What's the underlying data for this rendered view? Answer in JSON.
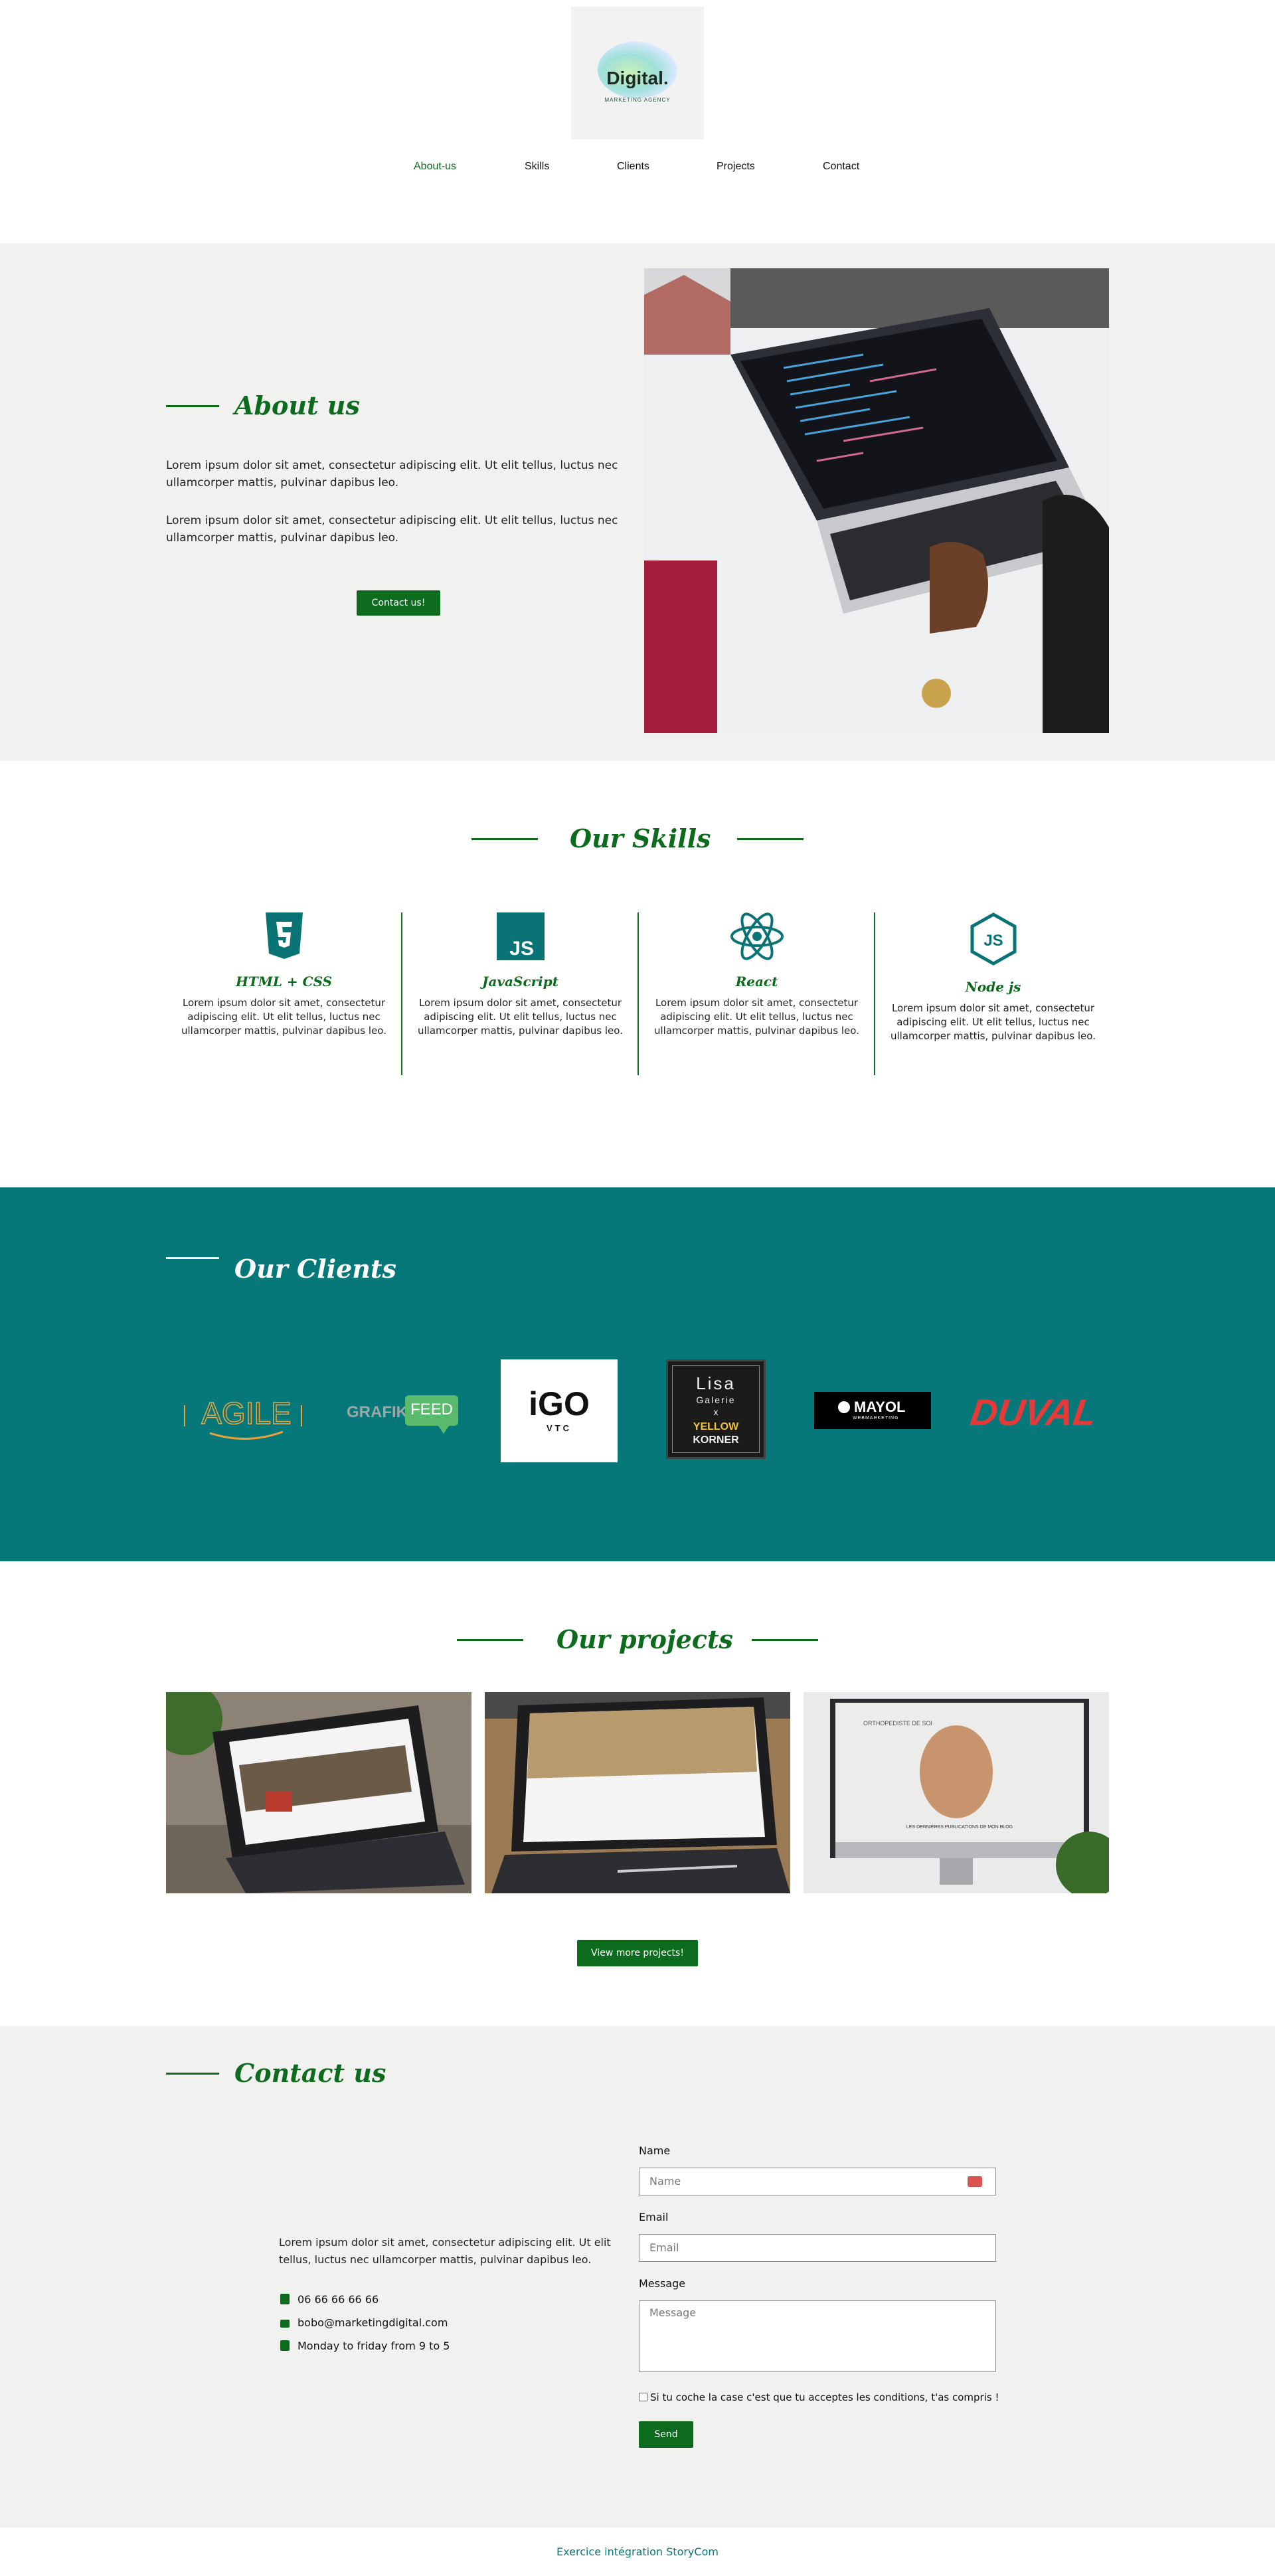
{
  "brand": {
    "name": "Digital.",
    "tagline": "MARKETING AGENCY"
  },
  "nav": [
    {
      "label": "About-us",
      "active": true
    },
    {
      "label": "Skills"
    },
    {
      "label": "Clients"
    },
    {
      "label": "Projects"
    },
    {
      "label": "Contact"
    }
  ],
  "about": {
    "title": "About us",
    "paragraph1": "Lorem ipsum dolor sit amet, consectetur adipiscing elit. Ut elit tellus, luctus nec ullamcorper mattis, pulvinar dapibus leo.",
    "paragraph2": "Lorem ipsum dolor sit amet, consectetur adipiscing elit. Ut elit tellus, luctus nec ullamcorper mattis, pulvinar dapibus leo.",
    "button": "Contact us!"
  },
  "skills": {
    "title": "Our Skills",
    "items": [
      {
        "title": "HTML + CSS",
        "text": "Lorem ipsum dolor sit amet, consectetur adipiscing elit. Ut elit tellus, luctus nec ullamcorper mattis, pulvinar dapibus leo.",
        "icon": "html5-icon"
      },
      {
        "title": "JavaScript",
        "text": "Lorem ipsum dolor sit amet, consectetur adipiscing elit. Ut elit tellus, luctus nec ullamcorper mattis, pulvinar dapibus leo.",
        "icon": "javascript-icon"
      },
      {
        "title": "React",
        "text": "Lorem ipsum dolor sit amet, consectetur adipiscing elit. Ut elit tellus, luctus nec ullamcorper mattis, pulvinar dapibus leo.",
        "icon": "react-icon"
      },
      {
        "title": "Node js",
        "text": "Lorem ipsum dolor sit amet, consectetur adipiscing elit. Ut elit tellus, luctus nec ullamcorper mattis, pulvinar dapibus leo.",
        "icon": "nodejs-icon"
      }
    ]
  },
  "clients": {
    "title": "Our Clients",
    "logos": {
      "agile": "AGILE",
      "grafik": "GRAFIK",
      "feed": "FEED",
      "igo_main": "iGO",
      "igo_sub": "VTC",
      "lisa_1": "Lisa",
      "lisa_2": "Galerie",
      "lisa_x": "x",
      "lisa_3": "YELLOW",
      "lisa_4": "KORNER",
      "mayol": "MAYOL",
      "mayol_sub": "WEBMARKETING",
      "duval": "DUVAL"
    }
  },
  "projects": {
    "title": "Our projects",
    "button": "View more projects!",
    "mock_text_1": "ORTHOPEDISTE DE SOI",
    "mock_text_2": "LES DERNIÈRES PUBLICATIONS DE MON BLOG"
  },
  "contact": {
    "title": "Contact us",
    "intro": "Lorem ipsum dolor sit amet, consectetur adipiscing elit. Ut elit tellus, luctus nec ullamcorper mattis, pulvinar dapibus leo.",
    "phone": "06 66 66 66 66",
    "email": "bobo@marketingdigital.com",
    "hours": "Monday to friday from 9 to 5",
    "form": {
      "name_label": "Name",
      "name_placeholder": "Name",
      "email_label": "Email",
      "email_placeholder": "Email",
      "message_label": "Message",
      "message_placeholder": "Message",
      "consent": "Si tu coche la case c'est que tu acceptes les conditions, t'as compris !",
      "submit": "Send"
    }
  },
  "footer": {
    "text": "Exercice intégration StoryCom"
  },
  "colors": {
    "accent": "#0d6b1e",
    "teal": "#07787a",
    "section_bg": "#f1f2f0"
  }
}
